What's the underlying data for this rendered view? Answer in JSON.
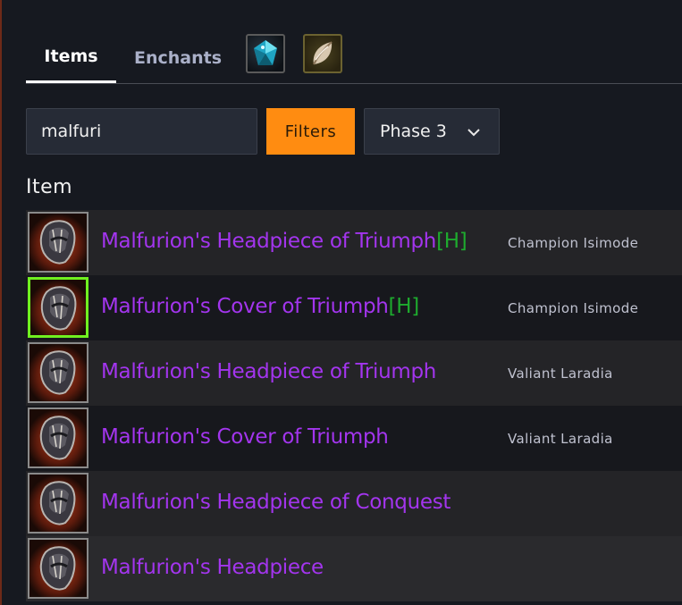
{
  "tabs": {
    "items_label": "Items",
    "enchants_label": "Enchants",
    "icons": [
      "meta-gem-icon",
      "prismatic-gem-icon"
    ]
  },
  "search": {
    "value": "malfuri",
    "filters_label": "Filters",
    "phase_value": "Phase 3"
  },
  "table": {
    "column_header": "Item",
    "rows": [
      {
        "name": "Malfurion's Headpiece of Triumph",
        "tag": "[H]",
        "source": "Champion Isimode"
      },
      {
        "name": "Malfurion's Cover of Triumph",
        "tag": "[H]",
        "source": "Champion Isimode"
      },
      {
        "name": "Malfurion's Headpiece of Triumph",
        "tag": "",
        "source": "Valiant Laradia"
      },
      {
        "name": "Malfurion's Cover of Triumph",
        "tag": "",
        "source": "Valiant Laradia"
      },
      {
        "name": "Malfurion's Headpiece of Conquest",
        "tag": "",
        "source": ""
      },
      {
        "name": "Malfurion's Headpiece",
        "tag": "",
        "source": ""
      }
    ]
  },
  "colors": {
    "accent": "#ff8c11",
    "epic": "#a335ee",
    "heroic": "#1eaa2e",
    "selected_border": "#70f020"
  }
}
